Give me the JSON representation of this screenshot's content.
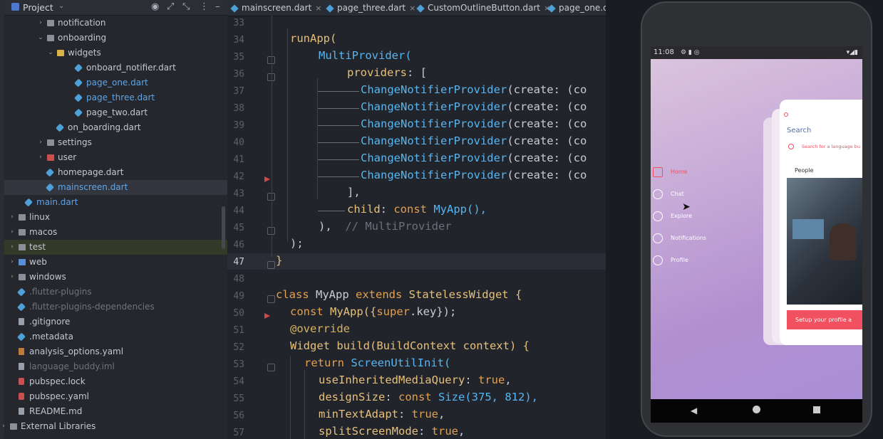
{
  "project_panel": {
    "title": "Project",
    "tree": [
      {
        "label": "notification",
        "kind": "folder",
        "depth": 1,
        "arrow": "›"
      },
      {
        "label": "onboarding",
        "kind": "folder",
        "depth": 1,
        "arrow": "⌄"
      },
      {
        "label": "widgets",
        "kind": "folder-yellow",
        "depth": 2,
        "arrow": "⌄"
      },
      {
        "label": "onboard_notifier.dart",
        "kind": "dart",
        "depth": 3
      },
      {
        "label": "page_one.dart",
        "kind": "dart",
        "depth": 3,
        "style": "blue"
      },
      {
        "label": "page_three.dart",
        "kind": "dart",
        "depth": 3,
        "style": "blue"
      },
      {
        "label": "page_two.dart",
        "kind": "dart",
        "depth": 3
      },
      {
        "label": "on_boarding.dart",
        "kind": "dart",
        "depth": 2
      },
      {
        "label": "settings",
        "kind": "folder",
        "depth": 1,
        "arrow": "›"
      },
      {
        "label": "user",
        "kind": "folder-red",
        "depth": 1,
        "arrow": "›"
      },
      {
        "label": "homepage.dart",
        "kind": "dart",
        "depth": 1
      },
      {
        "label": "mainscreen.dart",
        "kind": "dart",
        "depth": 1,
        "style": "blue",
        "selected": true
      },
      {
        "label": "main.dart",
        "kind": "dart",
        "depth": 0,
        "style": "blue"
      },
      {
        "label": "linux",
        "kind": "folder",
        "depth": -1,
        "arrow": "›"
      },
      {
        "label": "macos",
        "kind": "folder",
        "depth": -1,
        "arrow": "›"
      },
      {
        "label": "test",
        "kind": "folder",
        "depth": -1,
        "arrow": "›",
        "highlight": true
      },
      {
        "label": "web",
        "kind": "folder-blue",
        "depth": -1,
        "arrow": "›"
      },
      {
        "label": "windows",
        "kind": "folder",
        "depth": -1,
        "arrow": "›"
      },
      {
        "label": ".flutter-plugins",
        "kind": "dart",
        "depth": -1,
        "style": "dim"
      },
      {
        "label": ".flutter-plugins-dependencies",
        "kind": "dart",
        "depth": -1,
        "style": "dim"
      },
      {
        "label": ".gitignore",
        "kind": "file",
        "depth": -1
      },
      {
        "label": ".metadata",
        "kind": "dart",
        "depth": -1
      },
      {
        "label": "analysis_options.yaml",
        "kind": "yaml",
        "depth": -1
      },
      {
        "label": "language_buddy.iml",
        "kind": "file",
        "depth": -1,
        "style": "dim"
      },
      {
        "label": "pubspec.lock",
        "kind": "lock",
        "depth": -1
      },
      {
        "label": "pubspec.yaml",
        "kind": "lock",
        "depth": -1
      },
      {
        "label": "README.md",
        "kind": "file",
        "depth": -1
      },
      {
        "label": "External Libraries",
        "kind": "folder",
        "depth": -2,
        "arrow": "›"
      }
    ]
  },
  "editor": {
    "tabs": [
      "mainscreen.dart",
      "page_three.dart",
      "CustomOutlineButton.dart",
      "page_one.da"
    ],
    "line_numbers": [
      "33",
      "34",
      "35",
      "36",
      "37",
      "38",
      "39",
      "40",
      "41",
      "42",
      "43",
      "44",
      "45",
      "46",
      "47",
      "48",
      "49",
      "50",
      "51",
      "52",
      "53",
      "54",
      "55",
      "56",
      "57"
    ],
    "current_line": "47",
    "code": {
      "l34": "runApp(",
      "l35": "MultiProvider(",
      "l36a": "providers",
      "l36b": ": [",
      "cnp": "ChangeNotifierProvider",
      "cnp_tail": "(create: (co",
      "l43": "],",
      "l44a": "child",
      "l44b": ": ",
      "l44c": "const",
      "l44d": " MyApp(),",
      "l45a": "),  ",
      "l45b": "// MultiProvider",
      "l46": ");",
      "l47": "}",
      "l49a": "class",
      "l49b": " MyApp ",
      "l49c": "extends",
      "l49d": " StatelessWidget {",
      "l50a": "const",
      "l50b": " MyApp({",
      "l50c": "super",
      "l50d": ".key});",
      "l51": "@override",
      "l52a": "Widget",
      "l52b": " build",
      "l52c": "(BuildContext context) {",
      "l53a": "return",
      "l53b": " ScreenUtilInit(",
      "l54a": "useInheritedMediaQuery",
      "l54b": ": ",
      "l54c": "true",
      "l54d": ",",
      "l55a": "designSize",
      "l55b": ": ",
      "l55c": "const",
      "l55d": " Size(375, 812),",
      "l56a": "minTextAdapt",
      "l56b": ": ",
      "l56c": "true",
      "l56d": ",",
      "l57a": "splitScreenMode",
      "l57b": ": ",
      "l57c": "true",
      "l57d": ","
    }
  },
  "emulator": {
    "status_time": "11:08",
    "menu": [
      "Home",
      "Chat",
      "Explore",
      "Notifications",
      "Profile"
    ],
    "card_search_title": "Search",
    "card_search_placeholder": "Search for a language bu",
    "card_people_label": "People",
    "card_button": "Setup your profile a"
  },
  "colors": {
    "accent_red": "#f0505f",
    "dart_blue": "#4ea0d8"
  }
}
